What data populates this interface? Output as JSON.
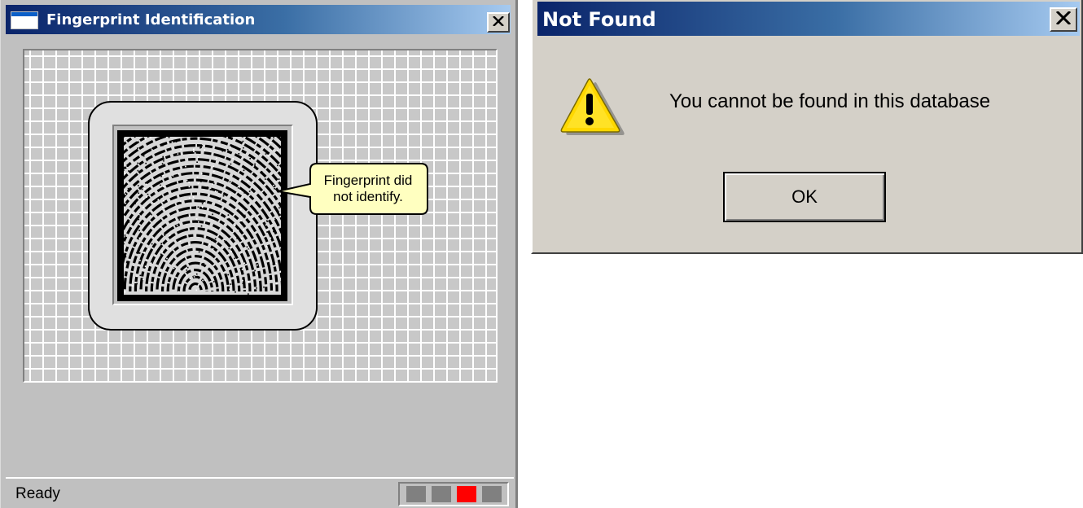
{
  "fingerprint_window": {
    "title": "Fingerprint Identification",
    "title_icon": "app-window-icon",
    "close_icon": "close-x-icon",
    "callout_text_line1": "Fingerprint did",
    "callout_text_line2": "not identify.",
    "status_text": "Ready",
    "status_leds": [
      {
        "color": "#808080"
      },
      {
        "color": "#808080"
      },
      {
        "color": "#ff0000"
      },
      {
        "color": "#808080"
      }
    ]
  },
  "dialog": {
    "title": "Not Found",
    "close_icon": "close-x-icon",
    "icon": "warning-icon",
    "message": "You cannot be found in this database",
    "ok_label": "OK"
  },
  "colors": {
    "titlebar_start": "#0a246a",
    "titlebar_end": "#a6caf0",
    "callout_fill": "#ffffc0",
    "led_active": "#ff0000",
    "led_inactive": "#808080"
  }
}
